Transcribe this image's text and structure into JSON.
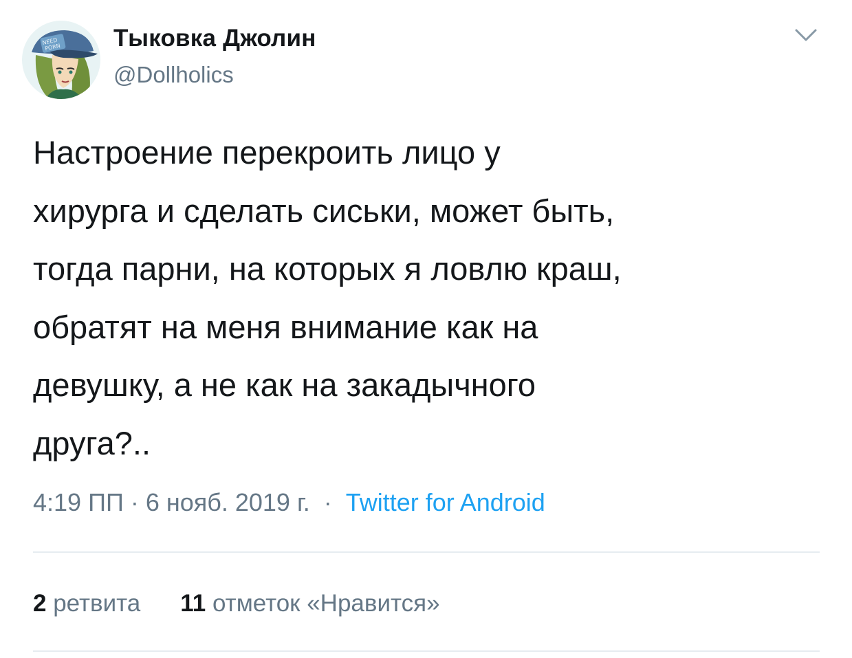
{
  "author": {
    "display_name": "Тыковка Джолин",
    "handle": "@Dollholics",
    "avatar_icon": "anime-avatar-icon",
    "avatar_cap_text": "NEED PORN"
  },
  "menu_icon": "chevron-down-icon",
  "tweet": {
    "text": "Настроение перекроить лицо у\nхирурга и сделать сиськи, может быть,\nтогда парни, на которых я ловлю краш,\nобратят на меня внимание как на\nдевушку, а не как на закадычного\nдруга?.."
  },
  "meta": {
    "time": "4:19 ПП",
    "separator": " · ",
    "date": "6 нояб. 2019 г.",
    "separator2": "  ·  ",
    "source": "Twitter for Android"
  },
  "stats": {
    "retweets_count": "2",
    "retweets_label": "ретвита",
    "likes_count": "11",
    "likes_label": "отметок «Нравится»"
  },
  "colors": {
    "text": "#14171a",
    "secondary": "#657786",
    "link": "#1da1f2",
    "divider": "#e6ecf0"
  }
}
